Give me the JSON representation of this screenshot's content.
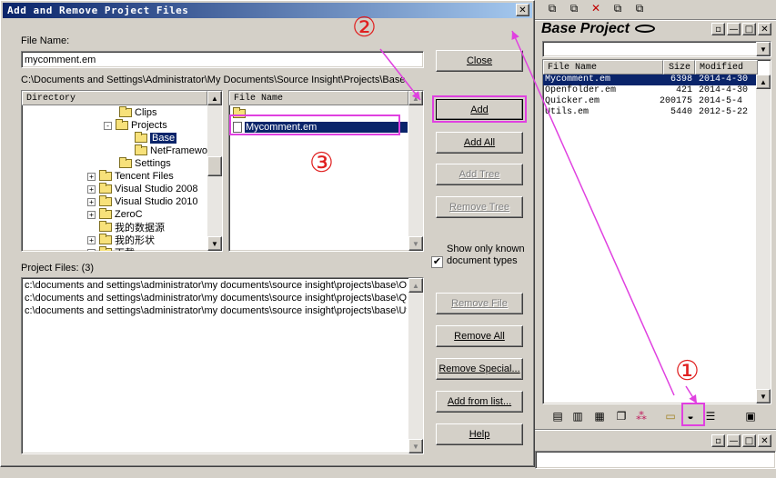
{
  "dialog": {
    "title": "Add and Remove Project Files",
    "close_glyph": "✕",
    "file_name_label": "File Name:",
    "file_name_value": "mycomment.em",
    "current_path": "C:\\Documents and Settings\\Administrator\\My Documents\\Source Insight\\Projects\\Base",
    "directory_header": "Directory",
    "file_name_header": "File Name",
    "tree": [
      {
        "label": "Clips",
        "indent": 1,
        "expand": "",
        "selected": false
      },
      {
        "label": "Projects",
        "indent": 0,
        "expand": "-",
        "selected": false
      },
      {
        "label": "Base",
        "indent": 2,
        "expand": "",
        "selected": true
      },
      {
        "label": "NetFrameworks",
        "indent": 2,
        "expand": "",
        "selected": false
      },
      {
        "label": "Settings",
        "indent": 1,
        "expand": "",
        "selected": false
      },
      {
        "label": "Tencent Files",
        "indent": -1,
        "expand": "+",
        "selected": false
      },
      {
        "label": "Visual Studio 2008",
        "indent": -1,
        "expand": "+",
        "selected": false
      },
      {
        "label": "Visual Studio 2010",
        "indent": -1,
        "expand": "+",
        "selected": false
      },
      {
        "label": "ZeroC",
        "indent": -1,
        "expand": "+",
        "selected": false
      },
      {
        "label": "我的数据源",
        "indent": -1,
        "expand": "",
        "selected": false
      },
      {
        "label": "我的形状",
        "indent": -1,
        "expand": "+",
        "selected": false
      },
      {
        "label": "下载",
        "indent": -1,
        "expand": "+",
        "selected": false
      }
    ],
    "file_list": [
      {
        "label": "..",
        "icon": "folder-icon",
        "selected": false
      },
      {
        "label": "Mycomment.em",
        "icon": "file-icon",
        "selected": true
      }
    ],
    "show_only_known": {
      "checked": true,
      "label": "Show only known document types"
    },
    "project_files_label": "Project Files: (3)",
    "project_files": [
      "c:\\documents and settings\\administrator\\my documents\\source insight\\projects\\base\\Op",
      "c:\\documents and settings\\administrator\\my documents\\source insight\\projects\\base\\Qu",
      "c:\\documents and settings\\administrator\\my documents\\source insight\\projects\\base\\Uti"
    ],
    "buttons": {
      "close": "Close",
      "add": "Add",
      "add_all": "Add All",
      "add_tree": "Add Tree",
      "remove_tree": "Remove Tree",
      "remove_file": "Remove File",
      "remove_all": "Remove All",
      "remove_special": "Remove Special...",
      "add_from_list": "Add from list...",
      "help": "Help"
    }
  },
  "annotations": {
    "one": "①",
    "two": "②",
    "three": "③",
    "color": "#e02020",
    "highlight": "#e040e0"
  },
  "project_panel": {
    "title": "Base Project",
    "columns": [
      "File Name",
      "Size",
      "Modified"
    ],
    "rows": [
      {
        "name": "Mycomment.em",
        "size": "6398",
        "modified": "2014-4-30",
        "selected": true
      },
      {
        "name": "Openfolder.em",
        "size": "421",
        "modified": "2014-4-30",
        "selected": false
      },
      {
        "name": "Quicker.em",
        "size": "200175",
        "modified": "2014-5-4",
        "selected": false
      },
      {
        "name": "Utils.em",
        "size": "5440",
        "modified": "2012-5-22",
        "selected": false
      }
    ],
    "window_buttons": [
      "▫",
      "—",
      "□",
      "✕"
    ]
  }
}
